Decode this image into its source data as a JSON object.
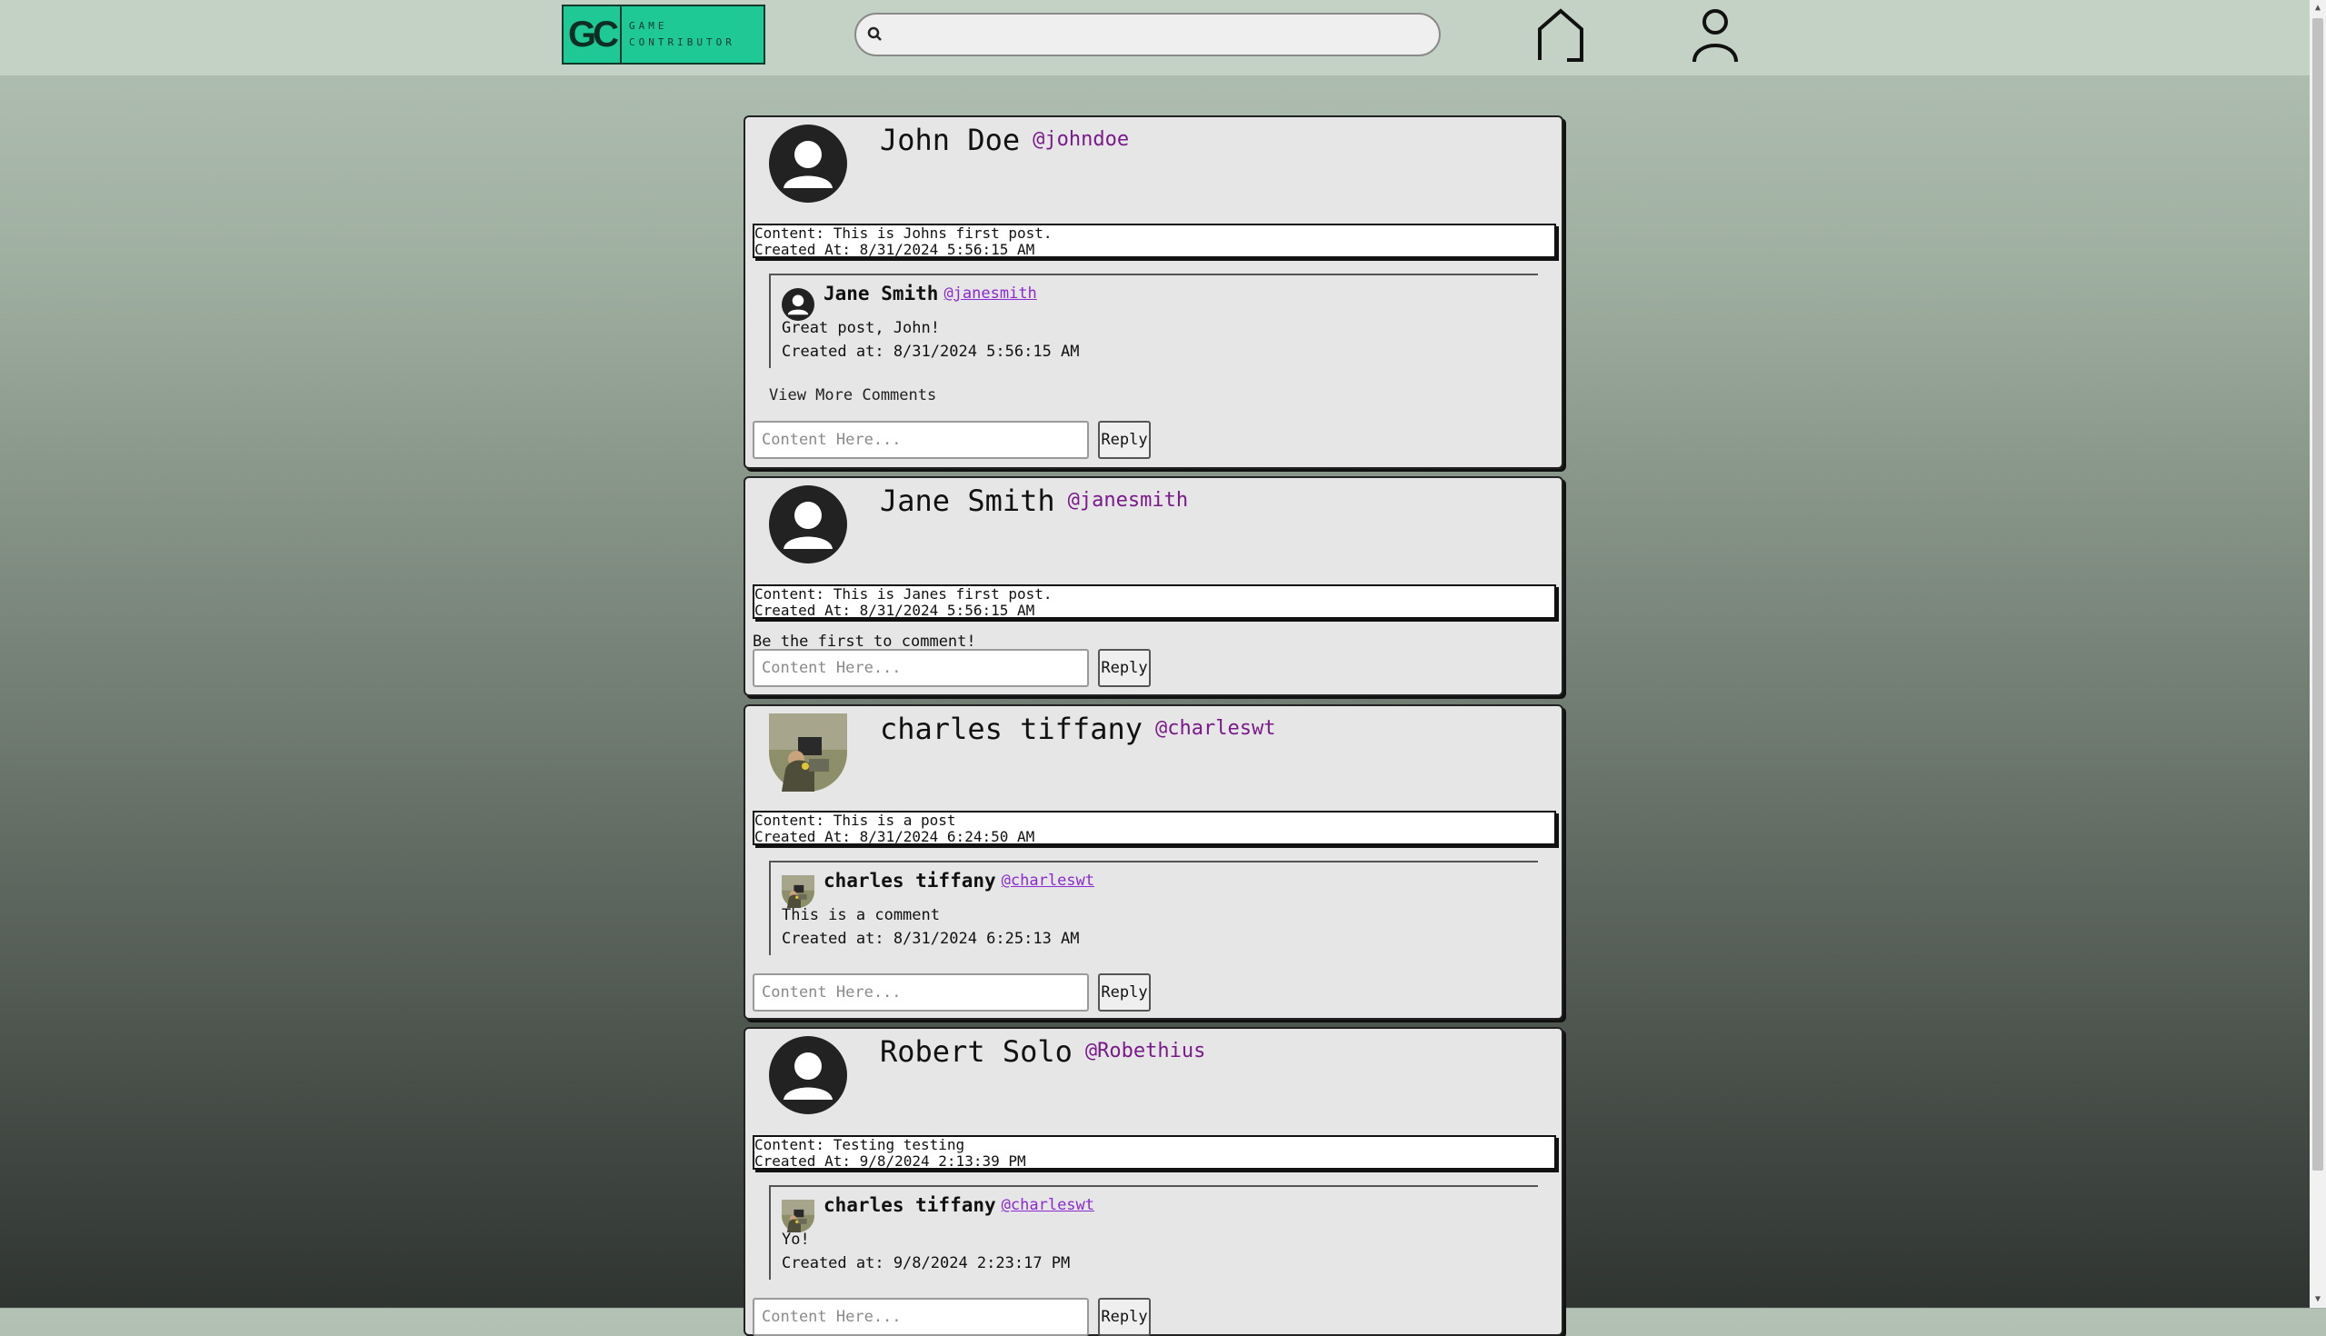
{
  "header": {
    "logo_mark": "GC",
    "logo_line1": "GAME",
    "logo_line2": "CONTRIBUTOR",
    "search_placeholder": ""
  },
  "reply_placeholder": "Content Here...",
  "reply_label": "Reply",
  "view_more_label": "View More Comments",
  "first_comment_label": "Be the first to comment!",
  "posts": [
    {
      "name": "John Doe",
      "handle": "@johndoe",
      "avatar": "default-avatar",
      "content": "Content: This is Johns first post.",
      "created": "Created At: 8/31/2024 5:56:15 AM",
      "comments": [
        {
          "name": "Jane Smith",
          "handle": "@janesmith",
          "avatar": "default-avatar",
          "text": "Great post, John!",
          "created": "Created at: 8/31/2024 5:56:15 AM"
        }
      ]
    },
    {
      "name": "Jane Smith",
      "handle": "@janesmith",
      "avatar": "default-avatar",
      "content": "Content: This is Janes first post.",
      "created": "Created At: 8/31/2024 5:56:15 AM",
      "comments": []
    },
    {
      "name": "charles tiffany",
      "handle": "@charleswt",
      "avatar": "photo-avatar",
      "content": "Content: This is a post",
      "created": "Created At: 8/31/2024 6:24:50 AM",
      "comments": [
        {
          "name": "charles tiffany",
          "handle": "@charleswt",
          "avatar": "photo-avatar",
          "text": "This is a comment",
          "created": "Created at: 8/31/2024 6:25:13 AM"
        }
      ]
    },
    {
      "name": "Robert Solo",
      "handle": "@Robethius",
      "avatar": "default-avatar",
      "content": "Content: Testing testing",
      "created": "Created At: 9/8/2024 2:13:39 PM",
      "comments": [
        {
          "name": "charles tiffany",
          "handle": "@charleswt",
          "avatar": "photo-avatar",
          "text": "Yo!",
          "created": "Created at: 9/8/2024 2:23:17 PM"
        }
      ]
    }
  ]
}
